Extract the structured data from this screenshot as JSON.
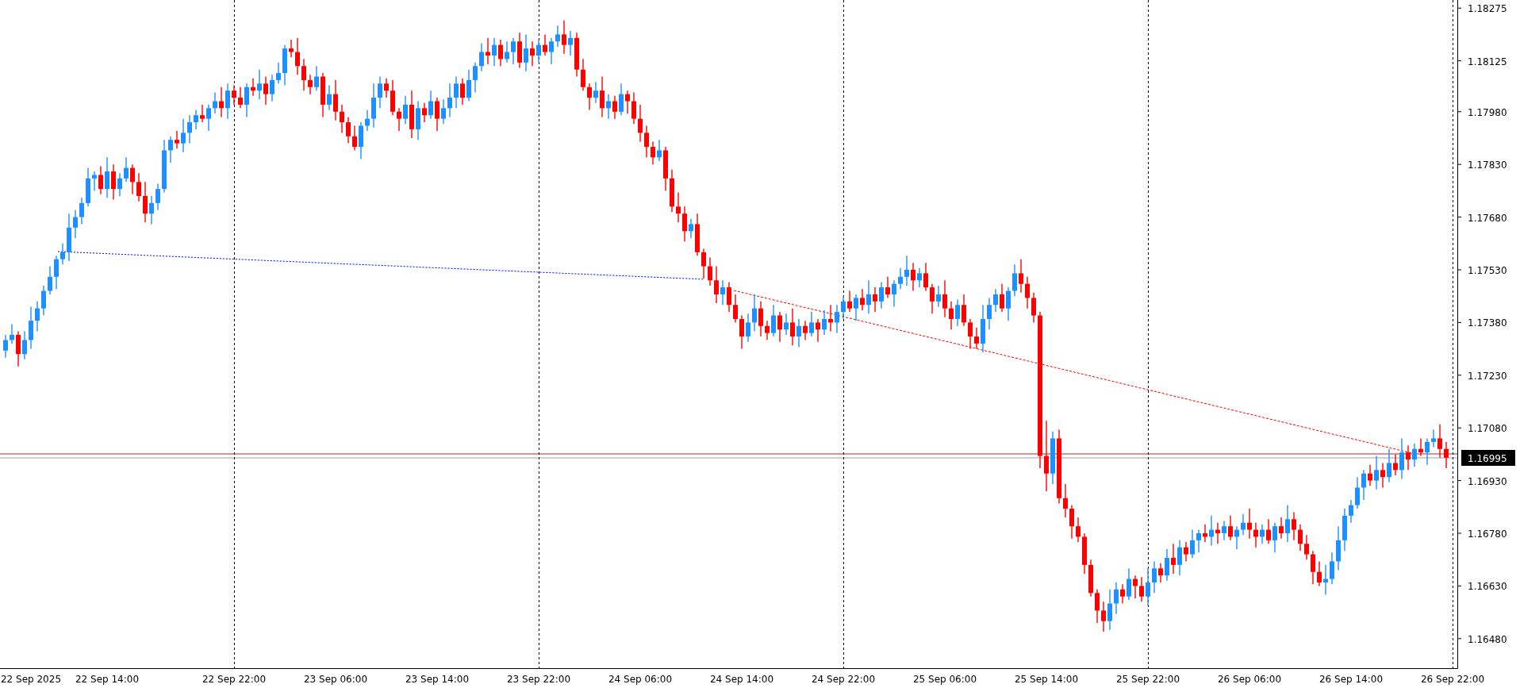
{
  "chart": {
    "current_price": "1.16995",
    "chart_data": {
      "type": "candlestick",
      "ylim": [
        1.16396,
        1.18298
      ],
      "yticks": [
        {
          "value": 1.18275,
          "label": "1.18275"
        },
        {
          "value": 1.18125,
          "label": "1.18125"
        },
        {
          "value": 1.1798,
          "label": "1.17980"
        },
        {
          "value": 1.1783,
          "label": "1.17830"
        },
        {
          "value": 1.1768,
          "label": "1.17680"
        },
        {
          "value": 1.1753,
          "label": "1.17530"
        },
        {
          "value": 1.1738,
          "label": "1.17380"
        },
        {
          "value": 1.1723,
          "label": "1.17230"
        },
        {
          "value": 1.1708,
          "label": "1.17080"
        },
        {
          "value": 1.1693,
          "label": "1.16930"
        },
        {
          "value": 1.1678,
          "label": "1.16780"
        },
        {
          "value": 1.1663,
          "label": "1.16630"
        },
        {
          "value": 1.1648,
          "label": "1.16480"
        }
      ],
      "categories": [
        null,
        null,
        null,
        null,
        "22 Sep 2025",
        null,
        null,
        null,
        null,
        null,
        null,
        null,
        null,
        null,
        null,
        null,
        "22 Sep 14:00",
        null,
        null,
        null,
        null,
        null,
        null,
        null,
        null,
        null,
        null,
        null,
        null,
        null,
        null,
        null,
        null,
        null,
        null,
        null,
        "22 Sep 22:00",
        null,
        null,
        null,
        null,
        null,
        null,
        null,
        null,
        null,
        null,
        null,
        null,
        null,
        null,
        null,
        "23 Sep 06:00",
        null,
        null,
        null,
        null,
        null,
        null,
        null,
        null,
        null,
        null,
        null,
        null,
        null,
        null,
        null,
        "23 Sep 14:00",
        null,
        null,
        null,
        null,
        null,
        null,
        null,
        null,
        null,
        null,
        null,
        null,
        null,
        null,
        null,
        "23 Sep 22:00",
        null,
        null,
        null,
        null,
        null,
        null,
        null,
        null,
        null,
        null,
        null,
        null,
        null,
        null,
        null,
        "24 Sep 06:00",
        null,
        null,
        null,
        null,
        null,
        null,
        null,
        null,
        null,
        null,
        null,
        null,
        null,
        null,
        null,
        "24 Sep 14:00",
        null,
        null,
        null,
        null,
        null,
        null,
        null,
        null,
        null,
        null,
        null,
        null,
        null,
        null,
        null,
        "24 Sep 22:00",
        null,
        null,
        null,
        null,
        null,
        null,
        null,
        null,
        null,
        null,
        null,
        null,
        null,
        null,
        null,
        "25 Sep 06:00",
        null,
        null,
        null,
        null,
        null,
        null,
        null,
        null,
        null,
        null,
        null,
        null,
        null,
        null,
        null,
        "25 Sep 14:00",
        null,
        null,
        null,
        null,
        null,
        null,
        null,
        null,
        null,
        null,
        null,
        null,
        null,
        null,
        null,
        "25 Sep 22:00",
        null,
        null,
        null,
        null,
        null,
        null,
        null,
        null,
        null,
        null,
        null,
        null,
        null,
        null,
        null,
        "26 Sep 06:00",
        null,
        null,
        null,
        null,
        null,
        null,
        null,
        null,
        null,
        null,
        null,
        null,
        null,
        null,
        null,
        "26 Sep 14:00",
        null,
        null,
        null,
        null,
        null,
        null,
        null,
        null,
        null,
        null,
        null,
        null,
        null,
        null,
        null,
        "26 Sep 22:00"
      ],
      "ohlc": [
        [
          1.173,
          1.17345,
          1.1728,
          1.1733
        ],
        [
          1.1733,
          1.17375,
          1.1732,
          1.17345
        ],
        [
          1.17345,
          1.17355,
          1.17255,
          1.1729
        ],
        [
          1.1729,
          1.17355,
          1.17275,
          1.1733
        ],
        [
          1.1733,
          1.17425,
          1.17305,
          1.17385
        ],
        [
          1.17385,
          1.1744,
          1.17355,
          1.1742
        ],
        [
          1.1742,
          1.17485,
          1.174,
          1.1747
        ],
        [
          1.1747,
          1.1754,
          1.1746,
          1.1751
        ],
        [
          1.1751,
          1.1757,
          1.17475,
          1.1756
        ],
        [
          1.1756,
          1.17605,
          1.17545,
          1.1758
        ],
        [
          1.1758,
          1.1769,
          1.17555,
          1.1765
        ],
        [
          1.1765,
          1.177,
          1.1762,
          1.1768
        ],
        [
          1.1768,
          1.17735,
          1.1766,
          1.1772
        ],
        [
          1.1772,
          1.1782,
          1.1771,
          1.1779
        ],
        [
          1.1779,
          1.1781,
          1.17755,
          1.178
        ],
        [
          1.178,
          1.17825,
          1.17745,
          1.1776
        ],
        [
          1.1776,
          1.1785,
          1.17735,
          1.1781
        ],
        [
          1.1781,
          1.1783,
          1.1773,
          1.1776
        ],
        [
          1.1776,
          1.17805,
          1.1774,
          1.1779
        ],
        [
          1.1779,
          1.1785,
          1.1778,
          1.1782
        ],
        [
          1.1782,
          1.1783,
          1.17745,
          1.1778
        ],
        [
          1.1778,
          1.17805,
          1.17725,
          1.1774
        ],
        [
          1.1774,
          1.1778,
          1.17665,
          1.1769
        ],
        [
          1.1769,
          1.1774,
          1.1766,
          1.1772
        ],
        [
          1.1772,
          1.17775,
          1.177,
          1.1776
        ],
        [
          1.1776,
          1.179,
          1.1775,
          1.1787
        ],
        [
          1.1787,
          1.1791,
          1.17835,
          1.179
        ],
        [
          1.179,
          1.17925,
          1.17875,
          1.1789
        ],
        [
          1.1789,
          1.1796,
          1.17865,
          1.1792
        ],
        [
          1.1792,
          1.1797,
          1.1789,
          1.1795
        ],
        [
          1.1795,
          1.17985,
          1.1793,
          1.1797
        ],
        [
          1.1797,
          1.18,
          1.1795,
          1.1796
        ],
        [
          1.1796,
          1.18,
          1.17925,
          1.1799
        ],
        [
          1.1799,
          1.18035,
          1.17975,
          1.1801
        ],
        [
          1.1801,
          1.1805,
          1.17965,
          1.1799
        ],
        [
          1.1799,
          1.1806,
          1.1796,
          1.1804
        ],
        [
          1.1804,
          1.18055,
          1.18,
          1.1802
        ],
        [
          1.1802,
          1.1805,
          1.1799,
          1.18
        ],
        [
          1.18,
          1.1806,
          1.17965,
          1.1805
        ],
        [
          1.1805,
          1.18075,
          1.18025,
          1.1804
        ],
        [
          1.1804,
          1.181,
          1.18015,
          1.1806
        ],
        [
          1.1806,
          1.1808,
          1.18,
          1.1803
        ],
        [
          1.1803,
          1.18085,
          1.1801,
          1.1807
        ],
        [
          1.1807,
          1.1812,
          1.1806,
          1.1809
        ],
        [
          1.1809,
          1.1817,
          1.18055,
          1.1816
        ],
        [
          1.1816,
          1.18185,
          1.18135,
          1.1815
        ],
        [
          1.1815,
          1.1819,
          1.18085,
          1.1811
        ],
        [
          1.1811,
          1.1813,
          1.1804,
          1.1807
        ],
        [
          1.1807,
          1.18085,
          1.1803,
          1.1805
        ],
        [
          1.1805,
          1.1811,
          1.1804,
          1.1808
        ],
        [
          1.1808,
          1.1809,
          1.17965,
          1.18
        ],
        [
          1.18,
          1.18055,
          1.17985,
          1.1803
        ],
        [
          1.1803,
          1.1807,
          1.17955,
          1.1798
        ],
        [
          1.1798,
          1.18,
          1.1792,
          1.1795
        ],
        [
          1.1795,
          1.17965,
          1.1789,
          1.1791
        ],
        [
          1.1791,
          1.1794,
          1.1787,
          1.1788
        ],
        [
          1.1788,
          1.1795,
          1.17845,
          1.1794
        ],
        [
          1.1794,
          1.17985,
          1.17925,
          1.1796
        ],
        [
          1.1796,
          1.1806,
          1.17935,
          1.1802
        ],
        [
          1.1802,
          1.1808,
          1.1799,
          1.1806
        ],
        [
          1.1806,
          1.18075,
          1.1802,
          1.1804
        ],
        [
          1.1804,
          1.1807,
          1.1797,
          1.1798
        ],
        [
          1.1798,
          1.1799,
          1.17925,
          1.1796
        ],
        [
          1.1796,
          1.18025,
          1.17945,
          1.18
        ],
        [
          1.18,
          1.1804,
          1.17905,
          1.1793
        ],
        [
          1.1793,
          1.1801,
          1.179,
          1.1799
        ],
        [
          1.1799,
          1.18005,
          1.1795,
          1.1797
        ],
        [
          1.1797,
          1.1804,
          1.1796,
          1.1801
        ],
        [
          1.1801,
          1.1802,
          1.17925,
          1.1796
        ],
        [
          1.1796,
          1.18015,
          1.17945,
          1.1799
        ],
        [
          1.1799,
          1.1806,
          1.17965,
          1.1802
        ],
        [
          1.1802,
          1.1808,
          1.1799,
          1.1806
        ],
        [
          1.1806,
          1.18075,
          1.18,
          1.1802
        ],
        [
          1.1802,
          1.181,
          1.1801,
          1.1807
        ],
        [
          1.1807,
          1.1812,
          1.18035,
          1.1811
        ],
        [
          1.1811,
          1.18175,
          1.18095,
          1.1815
        ],
        [
          1.1815,
          1.1819,
          1.18115,
          1.1814
        ],
        [
          1.1814,
          1.1819,
          1.1811,
          1.1817
        ],
        [
          1.1817,
          1.18185,
          1.1811,
          1.1813
        ],
        [
          1.1813,
          1.1818,
          1.1812,
          1.1815
        ],
        [
          1.1815,
          1.1819,
          1.18115,
          1.1818
        ],
        [
          1.1818,
          1.18205,
          1.18105,
          1.1812
        ],
        [
          1.1812,
          1.182,
          1.18095,
          1.1816
        ],
        [
          1.1816,
          1.1818,
          1.1811,
          1.1814
        ],
        [
          1.1814,
          1.18185,
          1.1812,
          1.1817
        ],
        [
          1.1817,
          1.182,
          1.1814,
          1.1815
        ],
        [
          1.1815,
          1.1819,
          1.18115,
          1.1818
        ],
        [
          1.1818,
          1.18225,
          1.18165,
          1.182
        ],
        [
          1.182,
          1.1824,
          1.18145,
          1.1817
        ],
        [
          1.1817,
          1.1821,
          1.1814,
          1.1819
        ],
        [
          1.1819,
          1.18205,
          1.1808,
          1.181
        ],
        [
          1.181,
          1.1813,
          1.1804,
          1.1805
        ],
        [
          1.1805,
          1.1806,
          1.17985,
          1.1802
        ],
        [
          1.1802,
          1.18065,
          1.18005,
          1.1804
        ],
        [
          1.1804,
          1.1808,
          1.17965,
          1.1799
        ],
        [
          1.1799,
          1.1803,
          1.1796,
          1.1801
        ],
        [
          1.1801,
          1.18025,
          1.1796,
          1.1798
        ],
        [
          1.1798,
          1.1806,
          1.1797,
          1.1803
        ],
        [
          1.1803,
          1.1804,
          1.17975,
          1.1801
        ],
        [
          1.1801,
          1.18035,
          1.17945,
          1.1796
        ],
        [
          1.1796,
          1.18,
          1.17895,
          1.1792
        ],
        [
          1.1792,
          1.1794,
          1.1785,
          1.1788
        ],
        [
          1.1788,
          1.17895,
          1.1783,
          1.1785
        ],
        [
          1.1785,
          1.179,
          1.1784,
          1.1787
        ],
        [
          1.1787,
          1.1788,
          1.17755,
          1.1779
        ],
        [
          1.1779,
          1.17815,
          1.17695,
          1.1771
        ],
        [
          1.1771,
          1.1775,
          1.17665,
          1.1769
        ],
        [
          1.1769,
          1.1771,
          1.1761,
          1.1764
        ],
        [
          1.1764,
          1.17675,
          1.1762,
          1.1766
        ],
        [
          1.1766,
          1.1769,
          1.1757,
          1.1758
        ],
        [
          1.1758,
          1.1759,
          1.17505,
          1.1754
        ],
        [
          1.1754,
          1.17565,
          1.17485,
          1.175
        ],
        [
          1.175,
          1.1754,
          1.17435,
          1.1746
        ],
        [
          1.1746,
          1.175,
          1.1743,
          1.1748
        ],
        [
          1.1748,
          1.17495,
          1.1741,
          1.1743
        ],
        [
          1.1743,
          1.1746,
          1.1738,
          1.1739
        ],
        [
          1.1739,
          1.174,
          1.17305,
          1.1734
        ],
        [
          1.1734,
          1.17405,
          1.17325,
          1.1738
        ],
        [
          1.1738,
          1.1746,
          1.17355,
          1.1742
        ],
        [
          1.1742,
          1.1744,
          1.1734,
          1.1737
        ],
        [
          1.1737,
          1.17385,
          1.1733,
          1.1735
        ],
        [
          1.1735,
          1.1743,
          1.1734,
          1.174
        ],
        [
          1.174,
          1.1741,
          1.17325,
          1.1736
        ],
        [
          1.1736,
          1.17405,
          1.17345,
          1.1738
        ],
        [
          1.1738,
          1.1742,
          1.17315,
          1.1734
        ],
        [
          1.1734,
          1.1739,
          1.1731,
          1.1737
        ],
        [
          1.1737,
          1.17385,
          1.1733,
          1.1735
        ],
        [
          1.1735,
          1.1741,
          1.1734,
          1.1738
        ],
        [
          1.1738,
          1.1739,
          1.17325,
          1.1736
        ],
        [
          1.1736,
          1.17415,
          1.17345,
          1.1739
        ],
        [
          1.1739,
          1.1743,
          1.17355,
          1.1738
        ],
        [
          1.1738,
          1.1743,
          1.1735,
          1.1741
        ],
        [
          1.1741,
          1.17455,
          1.1739,
          1.1744
        ],
        [
          1.1744,
          1.1747,
          1.1741,
          1.1742
        ],
        [
          1.1742,
          1.1746,
          1.17385,
          1.1745
        ],
        [
          1.1745,
          1.17475,
          1.17415,
          1.1743
        ],
        [
          1.1743,
          1.175,
          1.17405,
          1.1746
        ],
        [
          1.1746,
          1.1748,
          1.1741,
          1.1744
        ],
        [
          1.1744,
          1.17495,
          1.1742,
          1.1748
        ],
        [
          1.1748,
          1.1751,
          1.1745,
          1.1746
        ],
        [
          1.1746,
          1.175,
          1.17425,
          1.1749
        ],
        [
          1.1749,
          1.17535,
          1.17475,
          1.1751
        ],
        [
          1.1751,
          1.1757,
          1.17485,
          1.1753
        ],
        [
          1.1753,
          1.1755,
          1.1747,
          1.175
        ],
        [
          1.175,
          1.17535,
          1.1748,
          1.1752
        ],
        [
          1.1752,
          1.1755,
          1.1747,
          1.1748
        ],
        [
          1.1748,
          1.1749,
          1.17405,
          1.1744
        ],
        [
          1.1744,
          1.17485,
          1.17425,
          1.1746
        ],
        [
          1.1746,
          1.175,
          1.17395,
          1.1742
        ],
        [
          1.1742,
          1.1744,
          1.1736,
          1.1739
        ],
        [
          1.1739,
          1.17445,
          1.1737,
          1.1743
        ],
        [
          1.1743,
          1.1746,
          1.1737,
          1.1738
        ],
        [
          1.1738,
          1.1739,
          1.17305,
          1.1734
        ],
        [
          1.1734,
          1.17365,
          1.17305,
          1.1732
        ],
        [
          1.1732,
          1.1743,
          1.17295,
          1.1739
        ],
        [
          1.1739,
          1.1745,
          1.1736,
          1.1743
        ],
        [
          1.1743,
          1.17475,
          1.1741,
          1.1746
        ],
        [
          1.1746,
          1.1749,
          1.1741,
          1.1742
        ],
        [
          1.1742,
          1.1748,
          1.17385,
          1.1747
        ],
        [
          1.1747,
          1.17545,
          1.17455,
          1.1752
        ],
        [
          1.1752,
          1.1756,
          1.17465,
          1.1749
        ],
        [
          1.1749,
          1.1751,
          1.1742,
          1.1745
        ],
        [
          1.1745,
          1.17465,
          1.1738,
          1.174
        ],
        [
          1.174,
          1.1741,
          1.16965,
          1.17
        ],
        [
          1.17,
          1.171,
          1.169,
          1.1695
        ],
        [
          1.1695,
          1.1707,
          1.1692,
          1.1705
        ],
        [
          1.1705,
          1.17075,
          1.16865,
          1.1688
        ],
        [
          1.1688,
          1.1692,
          1.16825,
          1.1685
        ],
        [
          1.1685,
          1.1686,
          1.16765,
          1.168
        ],
        [
          1.168,
          1.16825,
          1.16755,
          1.1677
        ],
        [
          1.1677,
          1.1678,
          1.16665,
          1.1669
        ],
        [
          1.1669,
          1.16705,
          1.166,
          1.1661
        ],
        [
          1.1661,
          1.1662,
          1.16525,
          1.1656
        ],
        [
          1.1656,
          1.16585,
          1.165,
          1.1653
        ],
        [
          1.1653,
          1.1662,
          1.16505,
          1.1658
        ],
        [
          1.1658,
          1.1664,
          1.1655,
          1.1662
        ],
        [
          1.1662,
          1.16635,
          1.1658,
          1.166
        ],
        [
          1.166,
          1.1668,
          1.1659,
          1.1665
        ],
        [
          1.1665,
          1.1666,
          1.16595,
          1.1663
        ],
        [
          1.1663,
          1.16655,
          1.16585,
          1.166
        ],
        [
          1.166,
          1.1668,
          1.16575,
          1.1664
        ],
        [
          1.1664,
          1.167,
          1.1661,
          1.1668
        ],
        [
          1.1668,
          1.16695,
          1.1664,
          1.1666
        ],
        [
          1.1666,
          1.16735,
          1.16645,
          1.1671
        ],
        [
          1.1671,
          1.1675,
          1.16665,
          1.1669
        ],
        [
          1.1669,
          1.1676,
          1.1666,
          1.1674
        ],
        [
          1.1674,
          1.16755,
          1.167,
          1.1672
        ],
        [
          1.1672,
          1.1679,
          1.1671,
          1.1676
        ],
        [
          1.1676,
          1.1679,
          1.16725,
          1.1678
        ],
        [
          1.1678,
          1.16805,
          1.16755,
          1.1677
        ],
        [
          1.1677,
          1.1683,
          1.16745,
          1.1679
        ],
        [
          1.1679,
          1.1681,
          1.1675,
          1.1678
        ],
        [
          1.1678,
          1.16815,
          1.1676,
          1.168
        ],
        [
          1.168,
          1.1683,
          1.1676,
          1.1677
        ],
        [
          1.1677,
          1.168,
          1.16735,
          1.1679
        ],
        [
          1.1679,
          1.16835,
          1.16775,
          1.1681
        ],
        [
          1.1681,
          1.1685,
          1.16765,
          1.1679
        ],
        [
          1.1679,
          1.1681,
          1.1674,
          1.1677
        ],
        [
          1.1677,
          1.16805,
          1.1675,
          1.1679
        ],
        [
          1.1679,
          1.1682,
          1.1675,
          1.1676
        ],
        [
          1.1676,
          1.1681,
          1.16725,
          1.168
        ],
        [
          1.168,
          1.16825,
          1.16765,
          1.1678
        ],
        [
          1.1678,
          1.1686,
          1.16755,
          1.1682
        ],
        [
          1.1682,
          1.1684,
          1.1676,
          1.1679
        ],
        [
          1.1679,
          1.16805,
          1.1673,
          1.1675
        ],
        [
          1.1675,
          1.16775,
          1.16705,
          1.1672
        ],
        [
          1.1672,
          1.1673,
          1.16635,
          1.1667
        ],
        [
          1.1667,
          1.167,
          1.1663,
          1.1664
        ],
        [
          1.1664,
          1.1669,
          1.16605,
          1.1665
        ],
        [
          1.1665,
          1.16725,
          1.16635,
          1.167
        ],
        [
          1.167,
          1.168,
          1.16675,
          1.1676
        ],
        [
          1.1676,
          1.1685,
          1.1673,
          1.1683
        ],
        [
          1.1683,
          1.16875,
          1.1681,
          1.1686
        ],
        [
          1.1686,
          1.1694,
          1.1685,
          1.1691
        ],
        [
          1.1691,
          1.1696,
          1.16875,
          1.1695
        ],
        [
          1.1695,
          1.16975,
          1.16915,
          1.1693
        ],
        [
          1.1693,
          1.17,
          1.16905,
          1.1696
        ],
        [
          1.1696,
          1.1698,
          1.1691,
          1.1694
        ],
        [
          1.1694,
          1.1702,
          1.16925,
          1.1698
        ],
        [
          1.1698,
          1.17005,
          1.16945,
          1.1696
        ],
        [
          1.1696,
          1.1705,
          1.16935,
          1.1701
        ],
        [
          1.1701,
          1.1703,
          1.1696,
          1.1699
        ],
        [
          1.1699,
          1.17035,
          1.1697,
          1.1702
        ],
        [
          1.1702,
          1.1705,
          1.17,
          1.1701
        ],
        [
          1.1701,
          1.1705,
          1.16975,
          1.1704
        ],
        [
          1.1704,
          1.17075,
          1.17025,
          1.1705
        ],
        [
          1.1705,
          1.1709,
          1.16995,
          1.1702
        ],
        [
          1.1702,
          1.1704,
          1.16965,
          1.16995
        ],
        null
      ]
    }
  }
}
